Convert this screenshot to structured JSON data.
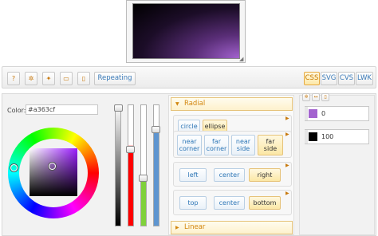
{
  "preview": {
    "gradient_type": "radial",
    "color_start": "#a363cf",
    "color_end": "#000000"
  },
  "toolbar": {
    "help_icon": "?",
    "repeating_label": "Repeating",
    "css_label": "CSS",
    "svg_label": "SVG",
    "cvs_label": "CVS",
    "lwk_label": "LWK"
  },
  "color": {
    "label": "Color:",
    "value": "#a363cf"
  },
  "radial": {
    "header": "Radial",
    "shape_options": [
      {
        "label": "circle",
        "selected": false
      },
      {
        "label": "ellipse",
        "selected": true
      }
    ],
    "size_options": [
      {
        "label": "near\ncorner",
        "selected": false
      },
      {
        "label": "far\ncorner",
        "selected": false
      },
      {
        "label": "near\nside",
        "selected": false
      },
      {
        "label": "far\nside",
        "selected": true
      }
    ],
    "x_options": [
      {
        "label": "left",
        "selected": false
      },
      {
        "label": "center",
        "selected": false
      },
      {
        "label": "right",
        "selected": true
      }
    ],
    "y_options": [
      {
        "label": "top",
        "selected": false
      },
      {
        "label": "center",
        "selected": false
      },
      {
        "label": "bottom",
        "selected": true
      }
    ]
  },
  "linear": {
    "header": "Linear"
  },
  "stops": [
    {
      "color": "#a363cf",
      "position": "0"
    },
    {
      "color": "#000000",
      "position": "100"
    }
  ],
  "sliders": {
    "alpha_level": 1.0,
    "red_level": 0.64,
    "green_level": 0.39,
    "blue_level": 0.81
  }
}
